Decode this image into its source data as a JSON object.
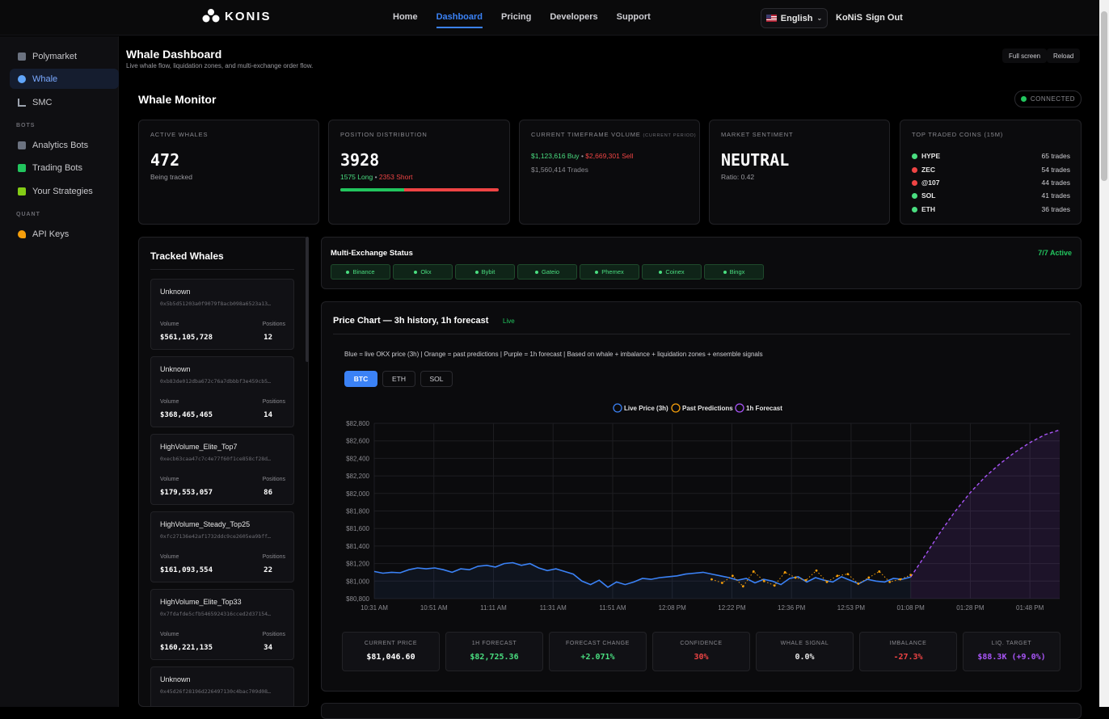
{
  "nav": {
    "brand": "KONIS",
    "links": [
      {
        "label": "Home"
      },
      {
        "label": "Dashboard"
      },
      {
        "label": "Pricing"
      },
      {
        "label": "Developers"
      },
      {
        "label": "Support"
      }
    ],
    "language": "English",
    "user": "KoNiS",
    "signout": "Sign Out"
  },
  "sidebar": {
    "items": [
      {
        "label": "Polymarket"
      },
      {
        "label": "Whale"
      },
      {
        "label": "SMC"
      },
      {
        "label": "Analytics Bots"
      },
      {
        "label": "Trading Bots"
      },
      {
        "label": "Your Strategies"
      },
      {
        "label": "API Keys"
      }
    ],
    "sections": [
      "BOTS",
      "QUANT"
    ]
  },
  "page": {
    "title": "Whale Dashboard",
    "subtitle": "Live whale flow, liquidation zones, and multi-exchange order flow.",
    "fullscreen": "Full screen",
    "reload": "Reload"
  },
  "monitor": {
    "title": "Whale Monitor",
    "status": "CONNECTED"
  },
  "cards": {
    "active": {
      "label": "ACTIVE WHALES",
      "value": "472",
      "sub": "Being tracked"
    },
    "dist": {
      "label": "POSITION DISTRIBUTION",
      "value": "3928",
      "long": "1575 Long",
      "sep": "•",
      "short": "2353 Short",
      "long_fraction": 0.401
    },
    "vol": {
      "label": "CURRENT TIMEFRAME VOLUME",
      "tag": "(CURRENT PERIOD)",
      "buy": "$1,123,616 Buy",
      "sep": "•",
      "sell": "$2,669,301 Sell",
      "trades": "$1,560,414 Trades"
    },
    "sent": {
      "label": "MARKET SENTIMENT",
      "value": "NEUTRAL",
      "sub": "Ratio: 0.42"
    },
    "coins": {
      "label": "TOP TRADED COINS (15M)",
      "items": [
        {
          "name": "HYPE",
          "trades": "65 trades",
          "color": "#4ade80"
        },
        {
          "name": "ZEC",
          "trades": "54 trades",
          "color": "#ef4444"
        },
        {
          "name": "@107",
          "trades": "44 trades",
          "color": "#ef4444"
        },
        {
          "name": "SOL",
          "trades": "41 trades",
          "color": "#4ade80"
        },
        {
          "name": "ETH",
          "trades": "36 trades",
          "color": "#4ade80"
        }
      ]
    }
  },
  "tracked": {
    "title": "Tracked Whales",
    "vol_label": "Volume",
    "pos_label": "Positions",
    "items": [
      {
        "name": "Unknown",
        "addr": "0x5b5d51203a0f9079f8acb098a6523a13…",
        "volume": "$561,105,728",
        "positions": "12"
      },
      {
        "name": "Unknown",
        "addr": "0xb83de012dba672c76a7dbbbf3e459cb5…",
        "volume": "$368,465,465",
        "positions": "14"
      },
      {
        "name": "HighVolume_Elite_Top7",
        "addr": "0xecb63caa47c7c4e77f60f1ce858cf28d…",
        "volume": "$179,553,057",
        "positions": "86"
      },
      {
        "name": "HighVolume_Steady_Top25",
        "addr": "0xfc27136e42af1732ddc9ce2605ea9bff…",
        "volume": "$161,093,554",
        "positions": "22"
      },
      {
        "name": "HighVolume_Elite_Top33",
        "addr": "0x7fdafde5cfb5465924316cced2d37154…",
        "volume": "$160,221,135",
        "positions": "34"
      },
      {
        "name": "Unknown",
        "addr": "0x45d26f28196d226497130c4bac709d08…",
        "volume": "",
        "positions": ""
      }
    ]
  },
  "multi": {
    "title": "Multi-Exchange Status",
    "active": "7/7 Active",
    "exchanges": [
      {
        "name": "Binance"
      },
      {
        "name": "Okx"
      },
      {
        "name": "Bybit"
      },
      {
        "name": "Gateio"
      },
      {
        "name": "Phemex"
      },
      {
        "name": "Coinex"
      },
      {
        "name": "Bingx"
      }
    ]
  },
  "price": {
    "title": "Price Chart — 3h history, 1h forecast",
    "live": "Live",
    "desc": "Blue = live OKX price (3h) | Orange = past predictions | Purple = 1h forecast | Based on whale + imbalance + liquidation zones + ensemble signals",
    "tabs": [
      {
        "label": "BTC"
      },
      {
        "label": "ETH"
      },
      {
        "label": "SOL"
      }
    ]
  },
  "chart_data": {
    "type": "line",
    "legend": [
      "Live Price (3h)",
      "Past Predictions",
      "1h Forecast"
    ],
    "legend_position": "top-center",
    "y_ticks": [
      "$82,800",
      "$82,600",
      "$82,400",
      "$82,200",
      "$82,000",
      "$81,800",
      "$81,600",
      "$81,400",
      "$81,200",
      "$81,000",
      "$80,800"
    ],
    "x_ticks": [
      "10:31 AM",
      "10:51 AM",
      "11:11 AM",
      "11:31 AM",
      "11:51 AM",
      "12:08 PM",
      "12:22 PM",
      "12:36 PM",
      "12:53 PM",
      "01:08 PM",
      "01:28 PM",
      "01:48 PM"
    ],
    "ylim": [
      80800,
      82800
    ],
    "grid": true,
    "colors": {
      "live": "#3b82f6",
      "pred": "#f59e0b",
      "forecast": "#a855f7"
    },
    "series": [
      {
        "name": "Live Price (3h)",
        "values": [
          81110,
          81090,
          81100,
          81095,
          81130,
          81150,
          81140,
          81150,
          81130,
          81100,
          81140,
          81130,
          81170,
          81180,
          81160,
          81200,
          81210,
          81180,
          81200,
          81150,
          81120,
          81140,
          81110,
          81080,
          81000,
          80960,
          81010,
          80930,
          80990,
          80960,
          80990,
          81030,
          81020,
          81040,
          81050,
          81060,
          81080,
          81090,
          81100,
          81080,
          81060,
          81040,
          81010,
          81030,
          80980,
          81020,
          81000,
          80960,
          81030,
          81050,
          80990,
          81040,
          81010,
          80990,
          81050,
          81010,
          80970,
          81020,
          81000,
          80990,
          81030,
          81020,
          81047
        ]
      },
      {
        "name": "Past Predictions",
        "values": [
          81020,
          80980,
          81060,
          80940,
          81110,
          81000,
          80950,
          81100,
          81040,
          81010,
          81120,
          80990,
          81060,
          81080,
          80970,
          81040,
          81110,
          80990,
          81020,
          81070
        ]
      },
      {
        "name": "1h Forecast",
        "values": [
          81047,
          81300,
          81560,
          81800,
          82010,
          82190,
          82340,
          82470,
          82580,
          82670,
          82725
        ]
      }
    ]
  },
  "stats": [
    {
      "label": "CURRENT PRICE",
      "value": "$81,046.60",
      "color": "#ffffff"
    },
    {
      "label": "1H FORECAST",
      "value": "$82,725.36",
      "color": "#4ade80"
    },
    {
      "label": "FORECAST CHANGE",
      "value": "+2.071%",
      "color": "#4ade80"
    },
    {
      "label": "CONFIDENCE",
      "value": "30%",
      "color": "#ef4444"
    },
    {
      "label": "WHALE SIGNAL",
      "value": "0.0%",
      "color": "#e6e6e6"
    },
    {
      "label": "IMBALANCE",
      "value": "-27.3%",
      "color": "#ef4444"
    },
    {
      "label": "LIQ. TARGET",
      "value": "$88.3K (+9.0%)",
      "color": "#a855f7"
    }
  ]
}
